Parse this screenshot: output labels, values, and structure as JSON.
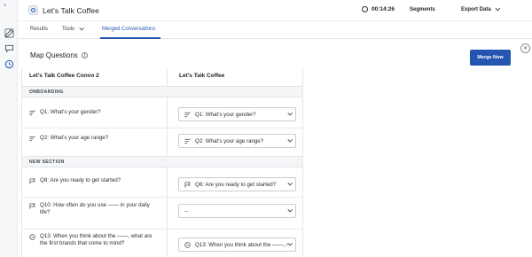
{
  "app": {
    "title": "Let's Talk Coffee",
    "timer": "00:14:26",
    "segments_label": "Segments",
    "export_label": "Export Data"
  },
  "tabs": [
    {
      "label": "Results"
    },
    {
      "label": "Tools"
    },
    {
      "label": "Merged Conversations"
    }
  ],
  "map": {
    "title": "Map Questions",
    "info_symbol": "i",
    "merge_label": "Merge Now",
    "close_symbol": "✕"
  },
  "columns": {
    "left": "Let's Talk Coffee Convo 2",
    "right": "Let's Talk Coffee"
  },
  "sections": [
    {
      "label": "ONBOARDING"
    },
    {
      "label": "NEW SECTION"
    }
  ],
  "rows": [
    {
      "question": "Q1: What's your gender?",
      "icon": "multiple-choice-icon",
      "mapped": "Q1: What's your gender?",
      "mapped_icon": "multiple-choice-icon"
    },
    {
      "question": "Q2: What's your age range?",
      "icon": "multiple-choice-icon",
      "mapped": "Q2: What's your age range?",
      "mapped_icon": "multiple-choice-icon"
    },
    {
      "question": "Q8: Are you ready to get started?",
      "icon": "flag-icon",
      "mapped": "Q8: Are you ready to get started?",
      "mapped_icon": "flag-icon"
    },
    {
      "question": "Q10: How often do you use —— in your daily life?",
      "icon": "flag-icon",
      "mapped": "--",
      "mapped_icon": ""
    },
    {
      "question": "Q13: When you think about the ——, what are the first brands that come to mind?",
      "icon": "open-ended-icon",
      "mapped": "Q13: When you think about the ——, wha",
      "mapped_icon": "open-ended-icon"
    }
  ],
  "colors": {
    "accent": "#2455b0",
    "section_bg": "#f4f5f7"
  }
}
